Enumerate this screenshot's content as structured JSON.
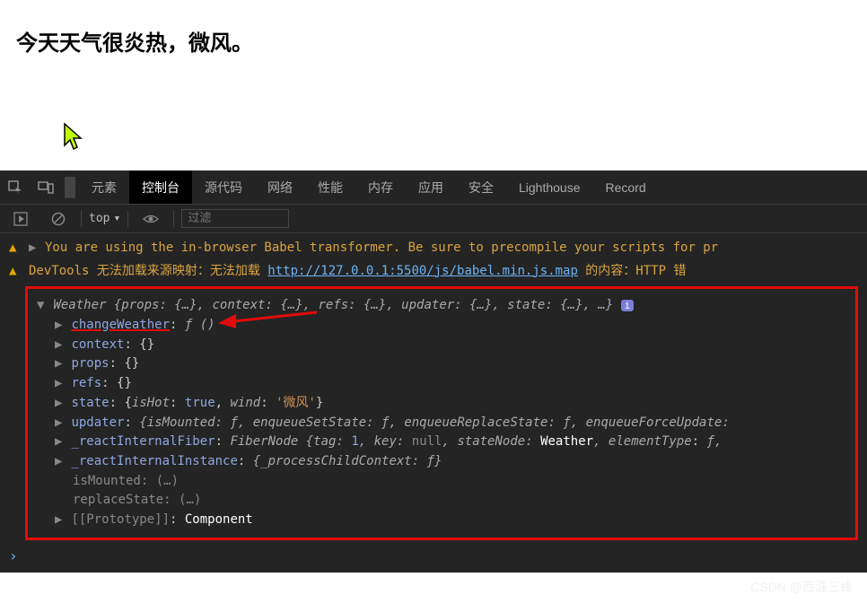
{
  "page": {
    "heading": "今天天气很炎热，微风。"
  },
  "tabs": {
    "elements": "元素",
    "console": "控制台",
    "sources": "源代码",
    "network": "网络",
    "performance": "性能",
    "memory": "内存",
    "application": "应用",
    "security": "安全",
    "lighthouse": "Lighthouse",
    "recorder": "Record"
  },
  "toolbar": {
    "context": "top",
    "filter_placeholder": "过滤"
  },
  "warnings": {
    "babel": "You are using the in-browser Babel transformer. Be sure to precompile your scripts for pr",
    "map_pre": "DevTools 无法加载来源映射：无法加载 ",
    "map_url": "http://127.0.0.1:5500/js/babel.min.js.map",
    "map_post": " 的内容：HTTP 错"
  },
  "obj": {
    "header_name": "Weather",
    "header_rest": " {props: {…}, context: {…}, refs: {…}, updater: {…}, state: {…}, …}",
    "changeWeather": "changeWeather",
    "fn": "ƒ ()",
    "context": "context",
    "props": "props",
    "refs": "refs",
    "state_key": "state",
    "state_isHot": "isHot",
    "state_isHot_v": "true",
    "state_wind": "wind",
    "state_wind_v": "'微风'",
    "updater_key": "updater",
    "updater_val": "{isMounted: ƒ, enqueueSetState: ƒ, enqueueReplaceState: ƒ, enqueueForceUpdate:",
    "fiber_key": "_reactInternalFiber",
    "fiber_val_pre": "FiberNode {tag: ",
    "fiber_tag": "1",
    "fiber_val_mid": ", key: ",
    "fiber_key_v": "null",
    "fiber_val_mid2": ", stateNode: ",
    "fiber_node": "Weather",
    "fiber_val_mid3": ", elementType",
    "fiber_tail": " ƒ,",
    "instance_key": "_reactInternalInstance",
    "instance_val": "{_processChildContext: ƒ}",
    "isMounted": "isMounted",
    "replaceState": "replaceState",
    "ellipsis": "(…)",
    "proto_key": "[[Prototype]]",
    "proto_val": "Component"
  },
  "watermark": "CSDN @西涯三锋"
}
